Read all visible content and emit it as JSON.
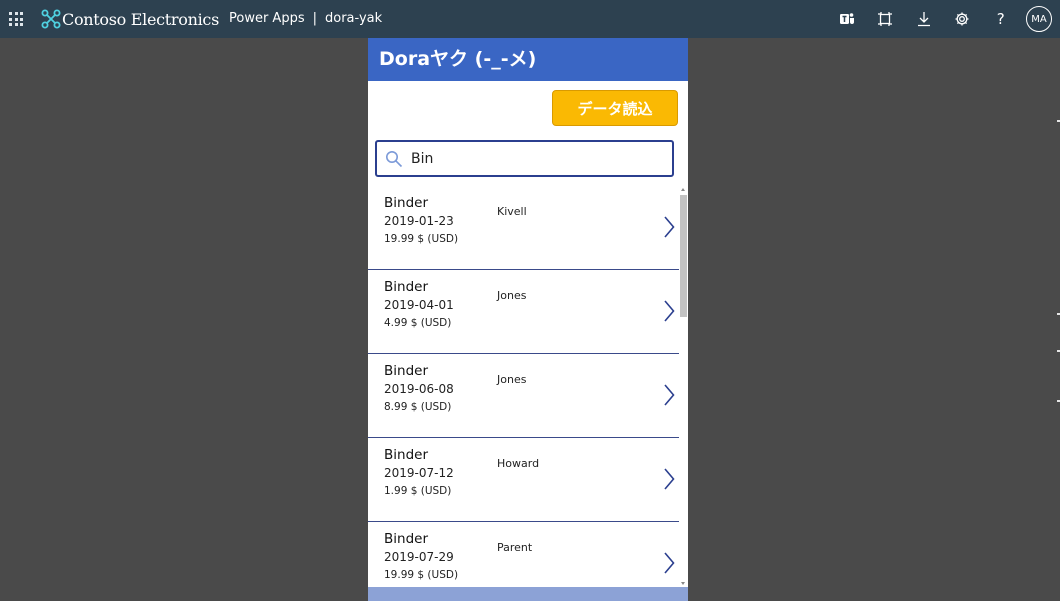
{
  "header": {
    "brand": "Contoso Electronics",
    "app_name": "Power Apps",
    "separator": "|",
    "app_title": "dora-yak",
    "icons": [
      "teams-icon",
      "fit-screen-icon",
      "download-icon",
      "gear-icon",
      "help-icon"
    ],
    "help_glyph": "?",
    "avatar_initials": "MA",
    "background": "#2d4150"
  },
  "app": {
    "title": "Doraヤク (-_-メ)",
    "title_bar_color": "#3a66c4",
    "load_button": {
      "label": "データ読込",
      "color": "#fab903"
    },
    "search": {
      "value": "Bin",
      "placeholder": ""
    },
    "items": [
      {
        "product": "Binder",
        "date": "2019-01-23",
        "price": "19.99 $ (USD)",
        "person": "Kivell"
      },
      {
        "product": "Binder",
        "date": "2019-04-01",
        "price": "4.99 $ (USD)",
        "person": "Jones"
      },
      {
        "product": "Binder",
        "date": "2019-06-08",
        "price": "8.99 $ (USD)",
        "person": "Jones"
      },
      {
        "product": "Binder",
        "date": "2019-07-12",
        "price": "1.99 $ (USD)",
        "person": "Howard"
      },
      {
        "product": "Binder",
        "date": "2019-07-29",
        "price": "19.99 $ (USD)",
        "person": "Parent"
      }
    ]
  }
}
